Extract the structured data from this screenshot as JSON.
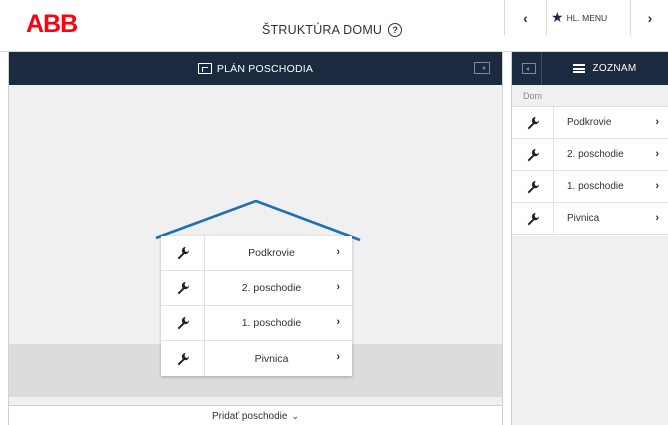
{
  "header": {
    "brand": "ABB",
    "title": "ŠTRUKTÚRA DOMU",
    "help_glyph": "?",
    "prev_glyph": "‹",
    "next_glyph": "›",
    "main_menu_label": "HL. MENU"
  },
  "floor_plan": {
    "bar_label": "PLÁN POSCHODIA",
    "floors": [
      {
        "label": "Podkrovie"
      },
      {
        "label": "2. poschodie"
      },
      {
        "label": "1. poschodie"
      },
      {
        "label": "Pivnica"
      }
    ],
    "add_floor_label": "Pridať poschodie",
    "add_floor_glyph": "⌄"
  },
  "list_panel": {
    "bar_label": "ZOZNAM",
    "breadcrumb": "Dom",
    "items": [
      {
        "label": "Podkrovie"
      },
      {
        "label": "2. poschodie"
      },
      {
        "label": "1. poschodie"
      },
      {
        "label": "Pivnica"
      }
    ]
  },
  "colors": {
    "brand_red": "#ff000f",
    "bar_navy": "#1b2a3f",
    "roof_blue": "#1f6fb5"
  },
  "icons": {
    "item_icon": "wrench-icon",
    "row_arrow": "›",
    "menu_icon": "star-icon"
  }
}
